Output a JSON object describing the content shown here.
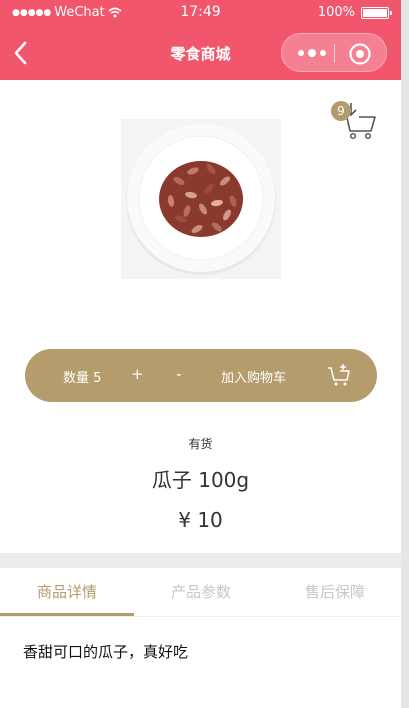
{
  "status_bar": {
    "carrier": "WeChat",
    "time": "17:49",
    "battery": "100%"
  },
  "nav": {
    "title": "零食商城"
  },
  "cart": {
    "badge_count": "9"
  },
  "product": {
    "image_icon": "sunflower-seeds-plate-image",
    "stock_status": "有货",
    "name": "瓜子 100g",
    "price": "¥ 10"
  },
  "action_bar": {
    "quantity_label": "数量 5",
    "plus": "+",
    "minus": "-",
    "add_to_cart": "加入购物车"
  },
  "tabs": [
    {
      "label": "商品详情",
      "active": true
    },
    {
      "label": "产品参数",
      "active": false
    },
    {
      "label": "售后保障",
      "active": false
    }
  ],
  "detail": {
    "description": "香甜可口的瓜子，真好吃"
  },
  "colors": {
    "header": "#f2566d",
    "accent": "#b39b6c"
  }
}
